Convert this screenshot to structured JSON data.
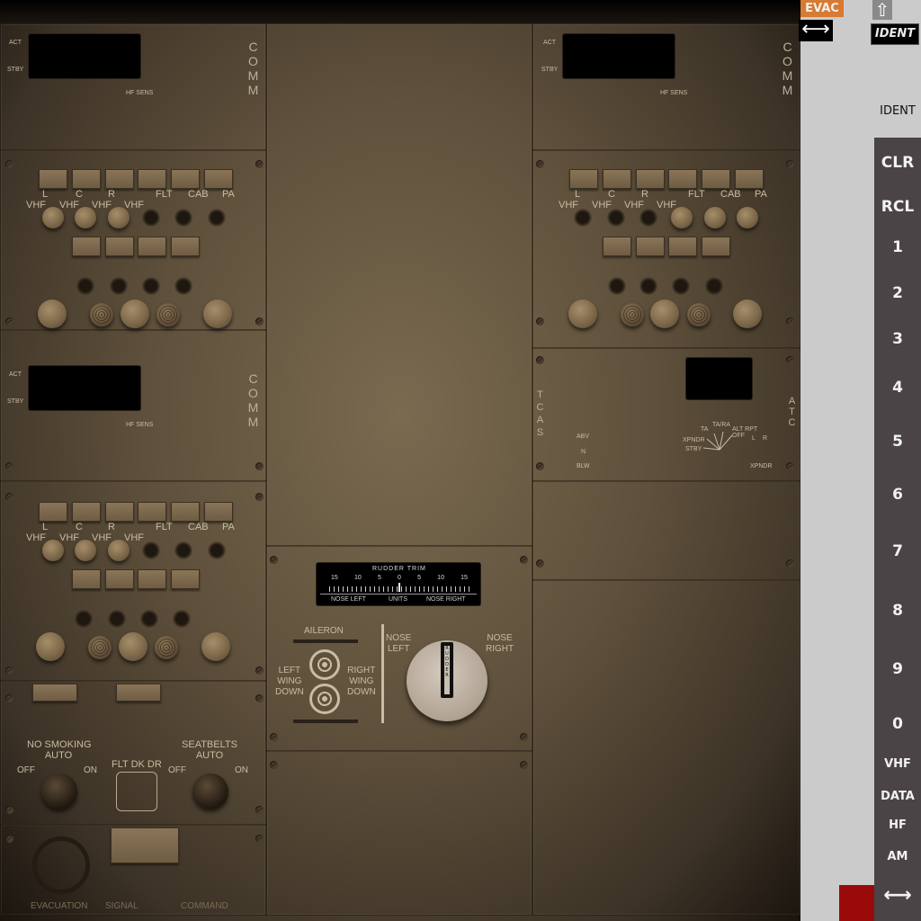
{
  "comm_panel": {
    "act_label": "ACT",
    "stby_label": "STBY",
    "hf_sens_label": "HF SENS",
    "comm_letters": [
      "C",
      "O",
      "M",
      "M"
    ]
  },
  "audio_panel": {
    "top_labels": [
      "L",
      "C",
      "R",
      "FLT",
      "CAB",
      "PA"
    ],
    "vhf_labels": [
      "VHF",
      "VHF",
      "VHF",
      "VHF"
    ]
  },
  "transponder_panel": {
    "tcas_letters": [
      "T",
      "C",
      "A",
      "S"
    ],
    "atc_letters": [
      "A",
      "T",
      "C"
    ],
    "abv": "ABV",
    "n": "N",
    "blw": "BLW",
    "ta": "TA",
    "ta_ra": "TA/RA",
    "alt_rpt_off": "ALT RPT\nOFF",
    "xpndr": "XPNDR",
    "stby": "STBY",
    "l": "L",
    "r": "R",
    "xpndr_select": "XPNDR"
  },
  "rudder_trim": {
    "title": "RUDDER TRIM",
    "scale": [
      "15",
      "10",
      "5",
      "0",
      "5",
      "10",
      "15"
    ],
    "nose_left_small": "NOSE LEFT",
    "units": "UNITS",
    "nose_right_small": "NOSE RIGHT",
    "aileron": "AILERON",
    "left_wing_down": "LEFT\nWING\nDOWN",
    "right_wing_down": "RIGHT\nWING\nDOWN",
    "nose_left": "NOSE\nLEFT",
    "nose_right": "NOSE\nRIGHT",
    "rudder_vertical": "RUDDER"
  },
  "lights_panel": {
    "no_smoking": "NO SMOKING\nAUTO",
    "off": "OFF",
    "on": "ON",
    "flt_dk_dr": "FLT DK DR",
    "seatbelts": "SEATBELTS\nAUTO",
    "evacuation": "EVACUATION",
    "signal": "SIGNAL",
    "command": "COMMAND"
  },
  "sidebar": {
    "evac_button": "EVAC",
    "ident_button": "IDENT",
    "ident_label": "IDENT",
    "keys": [
      "CLR",
      "RCL",
      "1",
      "2",
      "3",
      "4",
      "5",
      "6",
      "7",
      "8",
      "9",
      "0",
      "VHF",
      "DATA",
      "HF",
      "AM"
    ],
    "up_arrow": "⇧",
    "left_right_arrow": "⟷"
  },
  "colors": {
    "evac_orange": "#d77a33",
    "keypad_bg": "#4a4446",
    "red_indicator": "#9b0a0a"
  }
}
